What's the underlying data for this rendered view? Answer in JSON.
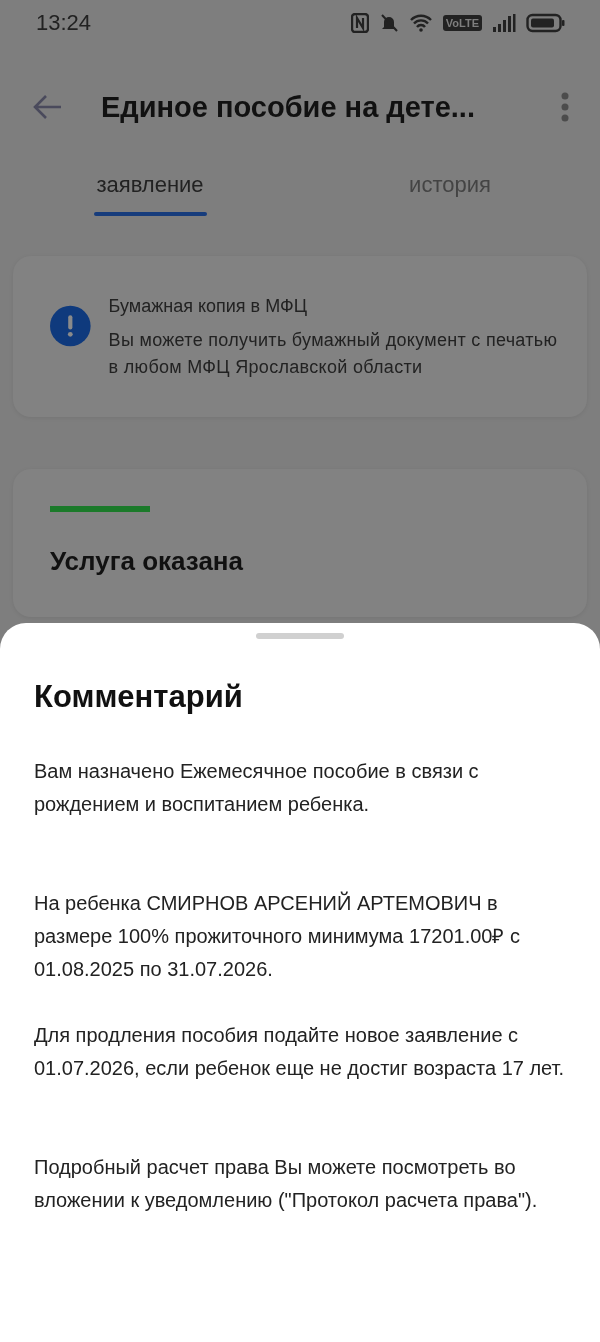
{
  "status_bar": {
    "time": "13:24",
    "volte": "VoLTE"
  },
  "header": {
    "title": "Единое пособие на дете..."
  },
  "tabs": [
    {
      "label": "заявление",
      "selected": true
    },
    {
      "label": "история",
      "selected": false
    }
  ],
  "notice": {
    "title": "Бумажная копия в МФЦ",
    "text": "Вы можете получить бумажный документ с печатью в любом МФЦ Ярославской области"
  },
  "status_card": {
    "color": "#1b7a2a",
    "title": "Услуга оказана"
  },
  "sheet": {
    "title": "Комментарий",
    "comment": "Вам назначено Ежемесячное пособие в связи с рождением и воспитанием ребенка.\n\n\nНа ребенка СМИРНОВ АРСЕНИЙ АРТЕМОВИЧ в размере 100% прожиточного минимума 17201.00₽ с 01.08.2025 по 31.07.2026.\n\nДля продления пособия подайте новое заявление с 01.07.2026, если ребенок еще не достиг возраста 17 лет.\n\n\nПодробный расчет права Вы можете посмотреть во вложении к уведомлению (\"Протокол расчета права\")."
  }
}
